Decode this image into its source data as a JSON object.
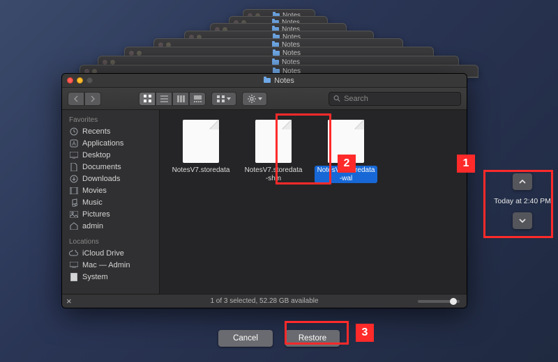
{
  "window": {
    "title": "Notes"
  },
  "toolbar": {
    "search_placeholder": "Search"
  },
  "sidebar": {
    "favorites_header": "Favorites",
    "locations_header": "Locations",
    "favorites": [
      {
        "icon": "clock",
        "label": "Recents"
      },
      {
        "icon": "app",
        "label": "Applications"
      },
      {
        "icon": "desktop",
        "label": "Desktop"
      },
      {
        "icon": "doc",
        "label": "Documents"
      },
      {
        "icon": "download",
        "label": "Downloads"
      },
      {
        "icon": "movie",
        "label": "Movies"
      },
      {
        "icon": "music",
        "label": "Music"
      },
      {
        "icon": "picture",
        "label": "Pictures"
      },
      {
        "icon": "home",
        "label": "admin"
      }
    ],
    "locations": [
      {
        "icon": "cloud",
        "label": "iCloud Drive"
      },
      {
        "icon": "disk",
        "label": "Mac — Admin"
      },
      {
        "icon": "disk",
        "label": "System"
      }
    ]
  },
  "files": [
    {
      "name": "NotesV7.storedata",
      "selected": false
    },
    {
      "name": "NotesV7.storedata-shm",
      "selected": false
    },
    {
      "name": "NotesV7.storedata-wal",
      "selected": true
    }
  ],
  "status": {
    "text": "1 of 3 selected, 52.28 GB available"
  },
  "timeline": {
    "label": "Today at 2:40 PM"
  },
  "actions": {
    "cancel": "Cancel",
    "restore": "Restore"
  },
  "annotations": {
    "a1": "1",
    "a2": "2",
    "a3": "3"
  }
}
